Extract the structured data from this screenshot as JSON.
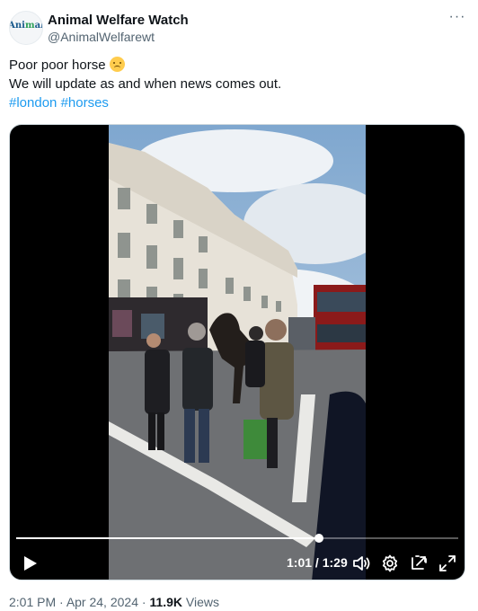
{
  "account": {
    "name": "Animal Welfare Watch",
    "handle": "@AnimalWelfarewt",
    "avatar_text": "Ani mal",
    "avatar_icon": "animal-welfare-logo"
  },
  "tweet": {
    "line1": "Poor poor horse",
    "line1_emoji": "disappointed-face-emoji",
    "line2": "We will update as and when news comes out.",
    "hashtags": [
      "#london",
      "#horses"
    ]
  },
  "video": {
    "current_time": "1:01",
    "separator": " / ",
    "duration": "1:29",
    "progress": 0.685,
    "controls": [
      "play-icon",
      "volume-icon",
      "settings-icon",
      "picture-in-picture-icon",
      "fullscreen-icon"
    ]
  },
  "footer": {
    "time": "2:01 PM",
    "dot": " · ",
    "date": "Apr 24, 2024",
    "dot2": " · ",
    "views_count": "11.9K",
    "views_label": " Views"
  },
  "colors": {
    "hashtag": "#1d9bf0",
    "secondary_text": "#536471",
    "primary_text": "#0f1419"
  }
}
